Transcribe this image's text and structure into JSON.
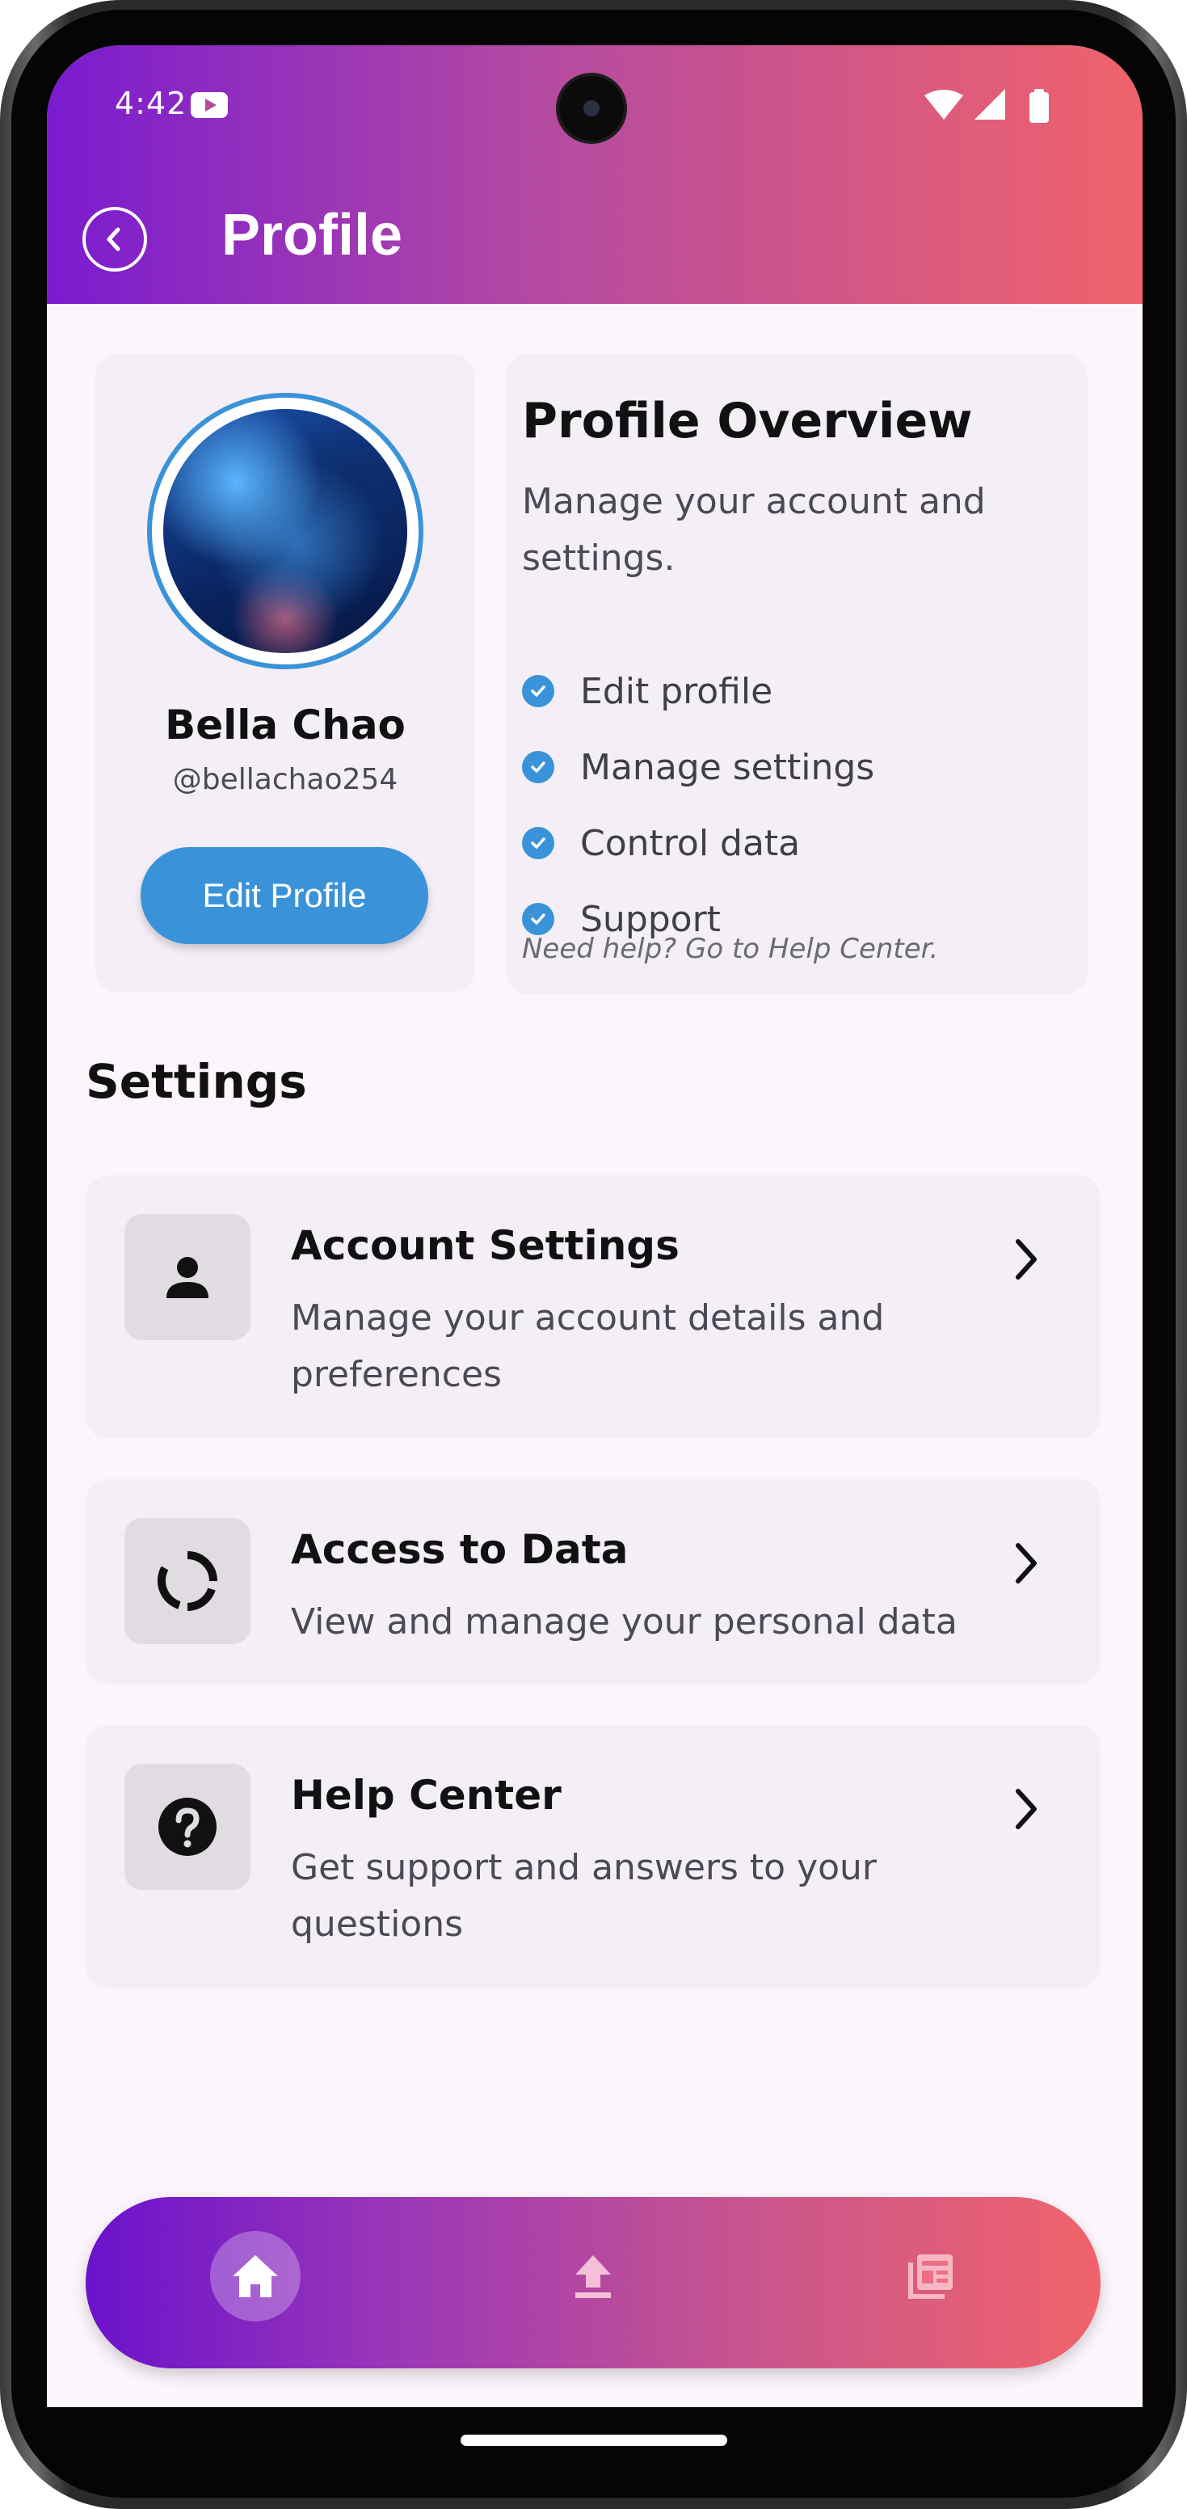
{
  "status_bar": {
    "time": "4:42",
    "icons": [
      "youtube-icon",
      "wifi-icon",
      "signal-icon",
      "battery-icon"
    ]
  },
  "header": {
    "title": "Profile",
    "back_icon": "chevron-left-icon"
  },
  "profile_card": {
    "name": "Bella Chao",
    "handle": "@bellachao254",
    "edit_button_label": "Edit Profile"
  },
  "overview": {
    "title": "Profile Overview",
    "description": "Manage your account and settings.",
    "items": [
      "Edit profile",
      "Manage settings",
      "Control data",
      "Support"
    ],
    "help_text": "Need help? Go to Help Center."
  },
  "settings": {
    "heading": "Settings",
    "rows": [
      {
        "title": "Account Settings",
        "subtitle": "Manage your account details and preferences",
        "icon": "person-icon"
      },
      {
        "title": "Access to Data",
        "subtitle": "View and manage your personal data",
        "icon": "data-ring-icon"
      },
      {
        "title": "Help Center",
        "subtitle": "Get support and answers to your questions",
        "icon": "help-icon"
      }
    ]
  },
  "bottom_nav": {
    "items": [
      {
        "name": "home",
        "icon": "home-icon",
        "active": true
      },
      {
        "name": "upload",
        "icon": "upload-icon",
        "active": false
      },
      {
        "name": "news",
        "icon": "news-icon",
        "active": false
      }
    ]
  },
  "colors": {
    "header_gradient_start": "#7a1bd0",
    "header_gradient_end": "#f0636a",
    "accent_blue": "#3a93d8",
    "background": "#fcf5fc",
    "card": "#f4eff6"
  }
}
